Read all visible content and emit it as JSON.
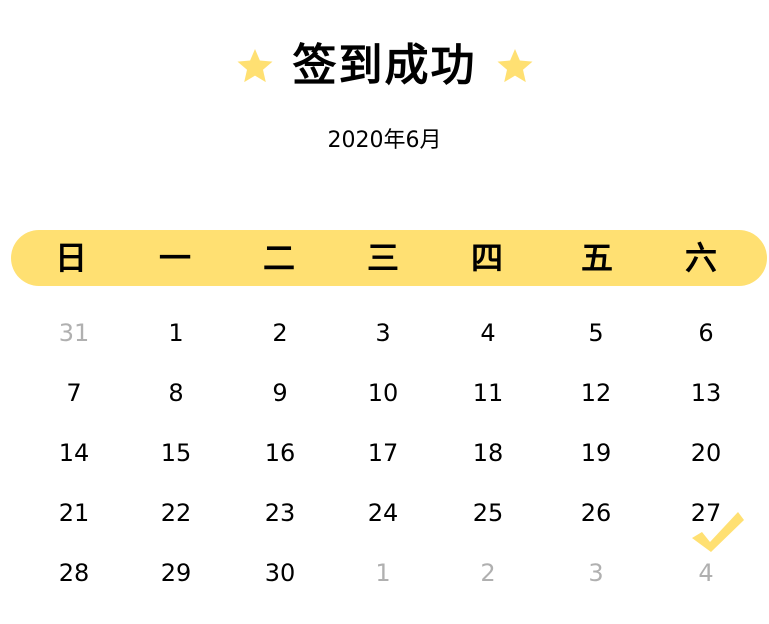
{
  "header": {
    "title": "签到成功",
    "month": "2020年6月",
    "star_color": "#FFE072"
  },
  "calendar": {
    "weekdays": [
      "日",
      "一",
      "二",
      "三",
      "四",
      "五",
      "六"
    ],
    "bar_color": "#FFE072",
    "check_color": "#FFE072",
    "checked_day": "27",
    "check_icon": "checkmark-icon",
    "rows": [
      [
        {
          "d": "31",
          "other": true
        },
        {
          "d": "1"
        },
        {
          "d": "2"
        },
        {
          "d": "3"
        },
        {
          "d": "4"
        },
        {
          "d": "5"
        },
        {
          "d": "6"
        }
      ],
      [
        {
          "d": "7"
        },
        {
          "d": "8"
        },
        {
          "d": "9"
        },
        {
          "d": "10"
        },
        {
          "d": "11"
        },
        {
          "d": "12"
        },
        {
          "d": "13"
        }
      ],
      [
        {
          "d": "14"
        },
        {
          "d": "15"
        },
        {
          "d": "16"
        },
        {
          "d": "17"
        },
        {
          "d": "18"
        },
        {
          "d": "19"
        },
        {
          "d": "20"
        }
      ],
      [
        {
          "d": "21"
        },
        {
          "d": "22"
        },
        {
          "d": "23"
        },
        {
          "d": "24"
        },
        {
          "d": "25"
        },
        {
          "d": "26"
        },
        {
          "d": "27"
        }
      ],
      [
        {
          "d": "28"
        },
        {
          "d": "29"
        },
        {
          "d": "30"
        },
        {
          "d": "1",
          "other": true
        },
        {
          "d": "2",
          "other": true
        },
        {
          "d": "3",
          "other": true
        },
        {
          "d": "4",
          "other": true
        }
      ]
    ]
  }
}
